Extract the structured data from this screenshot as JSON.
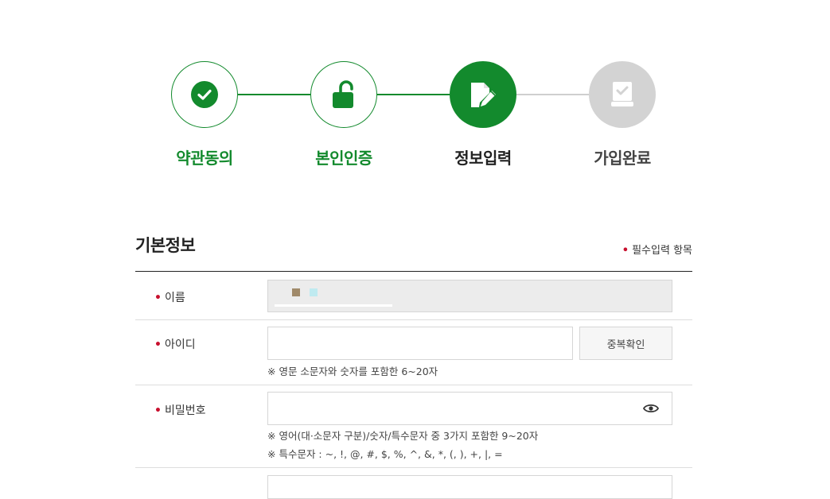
{
  "steps": [
    {
      "label": "약관동의",
      "icon": "check-circle-icon",
      "state": "done"
    },
    {
      "label": "본인인증",
      "icon": "unlock-icon",
      "state": "done"
    },
    {
      "label": "정보입력",
      "icon": "edit-document-icon",
      "state": "current"
    },
    {
      "label": "가입완료",
      "icon": "certificate-icon",
      "state": "todo"
    }
  ],
  "form": {
    "title": "기본정보",
    "required_note": "필수입력 항목",
    "required_mark": "•",
    "fields": {
      "name": {
        "label": "이름"
      },
      "id": {
        "label": "아이디",
        "button": "중복확인",
        "hint": "※ 영문 소문자와 숫자를 포함한 6~20자"
      },
      "password": {
        "label": "비밀번호",
        "hint1": "※ 영어(대·소문자 구분)/숫자/특수문자 중 3가지 포함한 9~20자",
        "hint2": "※ 특수문자 : ~, !, @, #, $, %, ^, &, *, (, ), +, |, ="
      }
    }
  },
  "colors": {
    "accent": "#138a2d",
    "required": "#c8102e",
    "inactive": "#d3d3d3"
  }
}
